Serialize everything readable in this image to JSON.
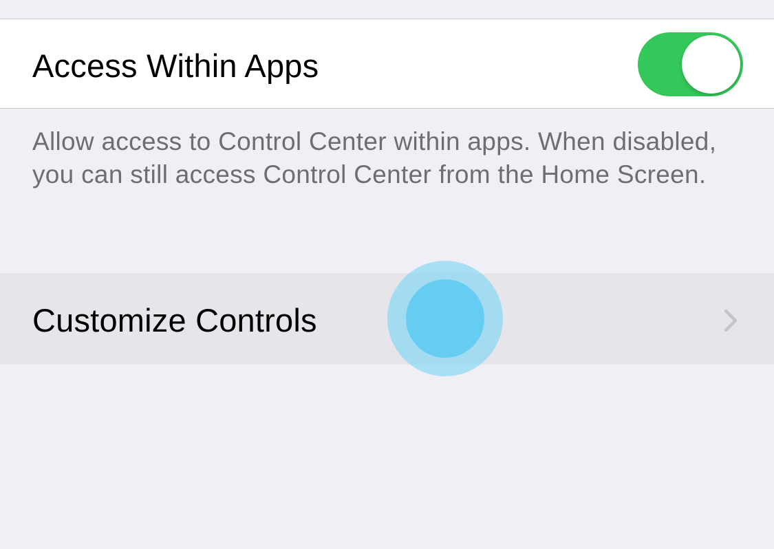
{
  "access_within_apps": {
    "label": "Access Within Apps",
    "toggle_on": true,
    "toggle_color": "#34c759"
  },
  "access_footer": {
    "text": "Allow access to Control Center within apps. When disabled, you can still access Control Center from the Home Screen."
  },
  "customize_controls": {
    "label": "Customize Controls",
    "icon": "chevron-right-icon"
  },
  "touch_indicator_color": "#66cdf2"
}
